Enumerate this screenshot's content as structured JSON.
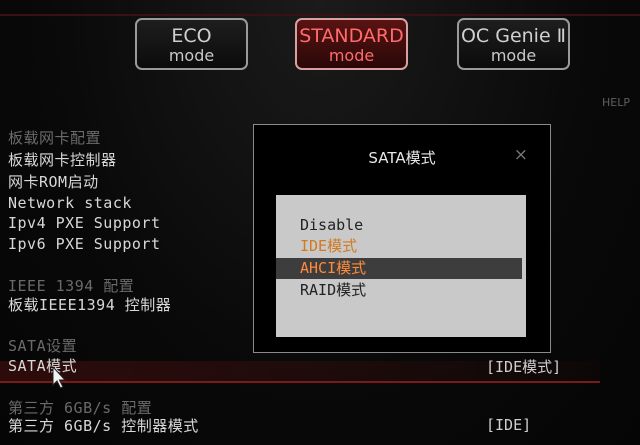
{
  "modes": [
    {
      "line1": "ECO",
      "line2": "mode",
      "active": false
    },
    {
      "line1": "STANDARD",
      "line2": "mode",
      "active": true
    },
    {
      "line1": "OC Genie Ⅱ",
      "line2": "mode",
      "active": false
    }
  ],
  "help": "HELP",
  "settings": {
    "lan_header": "板载网卡配置",
    "lan_controller": "板载网卡控制器",
    "lan_rom": "网卡ROM启动",
    "network_stack": "Network stack",
    "ipv4_pxe": "Ipv4 PXE Support",
    "ipv6_pxe": "Ipv6 PXE Support",
    "ieee_header": "IEEE 1394 配置",
    "ieee_controller": "板载IEEE1394 控制器",
    "sata_header": "SATA设置",
    "sata_mode": "SATA模式",
    "sata_mode_value": "[IDE模式]",
    "third_party_header": "第三方 6GB/s 配置",
    "third_party_mode": "第三方 6GB/s 控制器模式",
    "third_party_mode_value": "[IDE]"
  },
  "dialog": {
    "title": "SATA模式",
    "close": "×",
    "options": [
      "Disable",
      "IDE模式",
      "AHCI模式",
      "RAID模式"
    ],
    "selected_option": "AHCI模式"
  }
}
